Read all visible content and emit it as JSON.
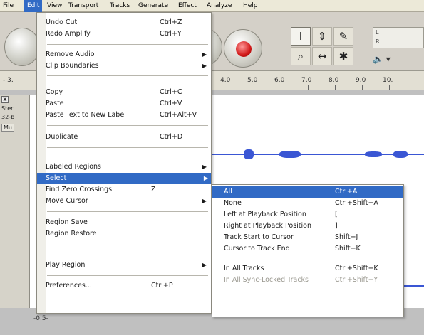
{
  "menubar": {
    "items": [
      "File",
      "Edit",
      "View",
      "Transport",
      "Tracks",
      "Generate",
      "Effect",
      "Analyze",
      "Help"
    ],
    "active": "Edit"
  },
  "ruler": {
    "left_label": "- 3.",
    "labels": [
      "4.0",
      "5.0",
      "6.0",
      "7.0",
      "8.0",
      "9.0",
      "10."
    ]
  },
  "trackinfo": {
    "close": "x",
    "name_fragment": "Ster",
    "format_fragment": "32-b",
    "mute_fragment": "Mu",
    "scale_label": "-0.5-"
  },
  "toolbar": {
    "meter_l": "L",
    "meter_r": "R",
    "volume_icon": "speaker-icon"
  },
  "edit_menu": {
    "items": [
      {
        "label": "Undo Cut",
        "shortcut": "Ctrl+Z"
      },
      {
        "label": "Redo Amplify",
        "shortcut": "Ctrl+Y"
      },
      {
        "label": "Remove Audio",
        "shortcut": ""
      },
      {
        "label": "Clip Boundaries",
        "shortcut": ""
      },
      {
        "label": "Copy",
        "shortcut": "Ctrl+C"
      },
      {
        "label": "Paste",
        "shortcut": "Ctrl+V"
      },
      {
        "label": "Paste Text to New Label",
        "shortcut": "Ctrl+Alt+V"
      },
      {
        "label": "Duplicate",
        "shortcut": "Ctrl+D"
      },
      {
        "label": "Labeled Regions",
        "shortcut": ""
      },
      {
        "label": "Select",
        "shortcut": ""
      },
      {
        "label": "Find Zero Crossings",
        "shortcut": "Z"
      },
      {
        "label": "Move Cursor",
        "shortcut": ""
      },
      {
        "label": "Region Save",
        "shortcut": ""
      },
      {
        "label": "Region Restore",
        "shortcut": ""
      },
      {
        "label": "Play Region",
        "shortcut": ""
      },
      {
        "label": "Preferences...",
        "shortcut": "Ctrl+P"
      }
    ]
  },
  "select_menu": {
    "items": [
      {
        "label": "All",
        "shortcut": "Ctrl+A"
      },
      {
        "label": "None",
        "shortcut": "Ctrl+Shift+A"
      },
      {
        "label": "Left at Playback Position",
        "shortcut": "["
      },
      {
        "label": "Right at Playback Position",
        "shortcut": "]"
      },
      {
        "label": "Track Start to Cursor",
        "shortcut": "Shift+J"
      },
      {
        "label": "Cursor to Track End",
        "shortcut": "Shift+K"
      },
      {
        "label": "In All Tracks",
        "shortcut": "Ctrl+Shift+K"
      },
      {
        "label": "In All Sync-Locked Tracks",
        "shortcut": "Ctrl+Shift+Y"
      }
    ]
  },
  "colors": {
    "highlight": "#316ac5",
    "waveform": "#3a56d4",
    "record": "#d21a1a"
  }
}
